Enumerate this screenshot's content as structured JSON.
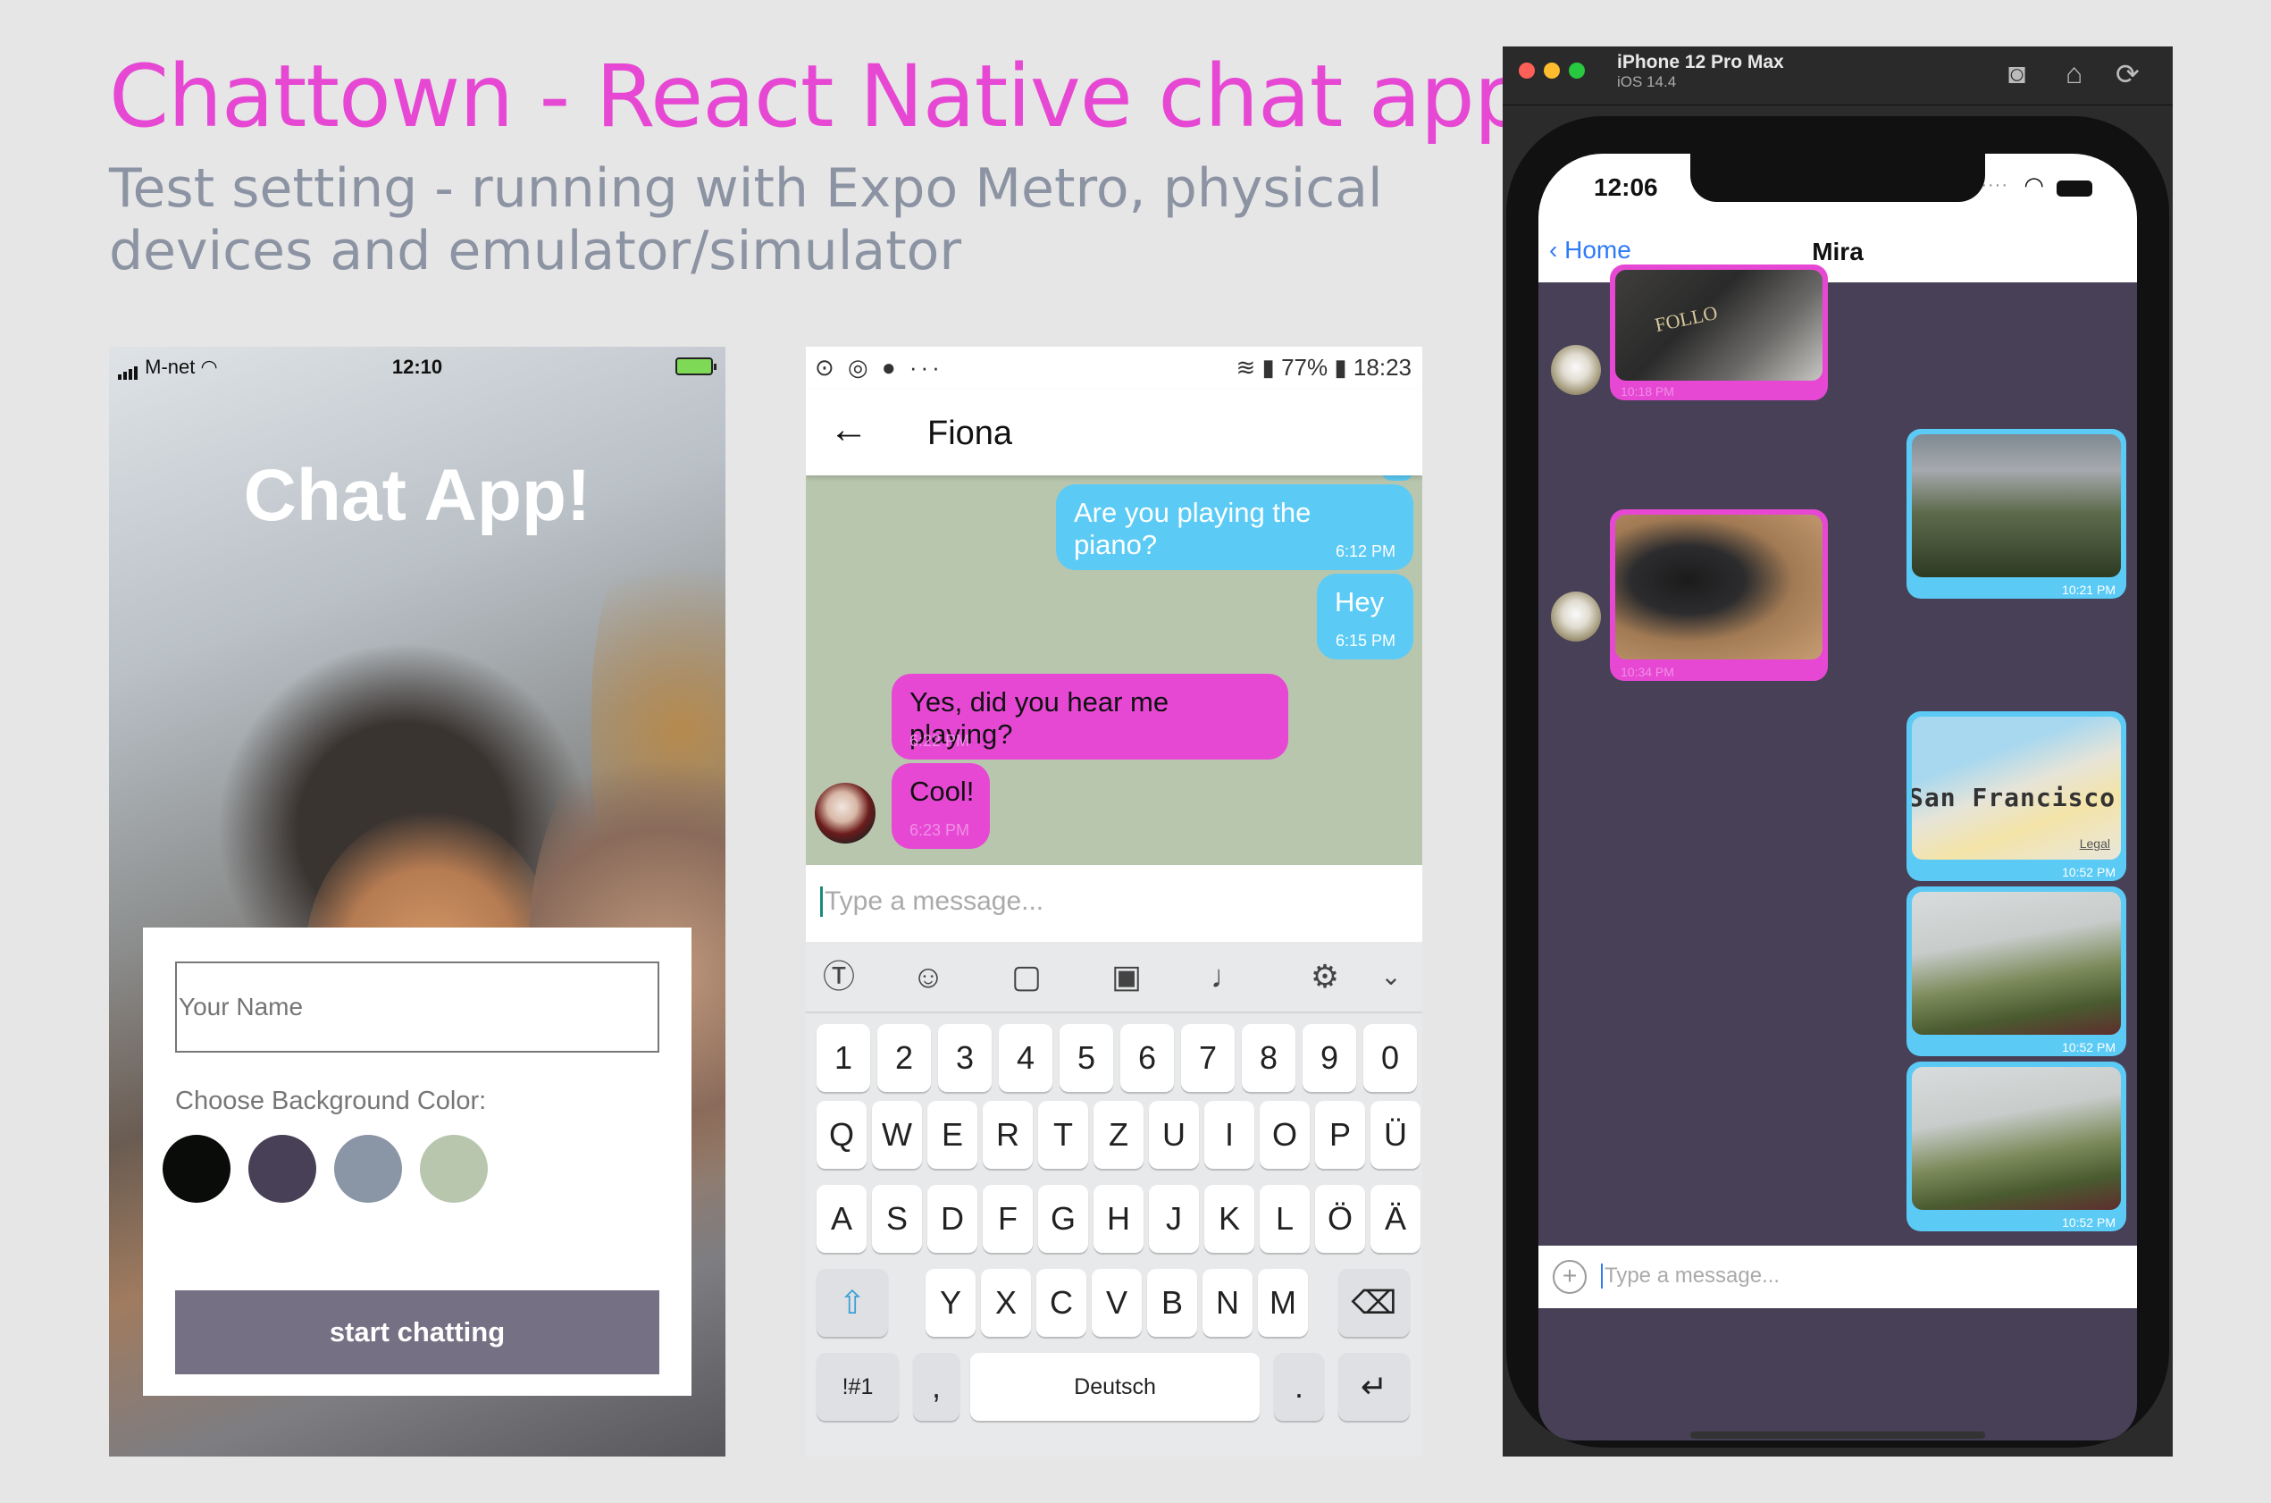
{
  "header": {
    "title": "Chattown - React Native chat app",
    "subtitle": "Test setting - running with Expo Metro, physical devices and emulator/simulator"
  },
  "login_screen": {
    "status": {
      "carrier": "M-net",
      "time": "12:10"
    },
    "app_title": "Chat App!",
    "name_placeholder": "Your Name",
    "bg_label": "Choose Background Color:",
    "colors": [
      "#090c08",
      "#474056",
      "#8a95a5",
      "#b9c6ae"
    ],
    "start_button": "start chatting"
  },
  "android_chat": {
    "status": {
      "left_icons": "⊙ ◎ ● ···",
      "battery": "77%",
      "time": "18:23"
    },
    "contact": "Fiona",
    "messages": [
      {
        "text": "Are you playing the piano?",
        "time": "6:12 PM",
        "side": "right"
      },
      {
        "text": "Hey",
        "time": "6:15 PM",
        "side": "right"
      },
      {
        "text": "Yes, did you hear me playing?",
        "time": "6:22 PM",
        "side": "left"
      },
      {
        "text": "Cool!",
        "time": "6:23 PM",
        "side": "left"
      }
    ],
    "input_placeholder": "Type a message...",
    "keyboard": {
      "tool_icons": [
        "text-mode-icon",
        "emoji-icon",
        "sticker-icon",
        "gif-icon",
        "mic-icon",
        "settings-icon",
        "collapse-icon"
      ],
      "row_numbers": [
        "1",
        "2",
        "3",
        "4",
        "5",
        "6",
        "7",
        "8",
        "9",
        "0"
      ],
      "row1": [
        "Q",
        "W",
        "E",
        "R",
        "T",
        "Z",
        "U",
        "I",
        "O",
        "P",
        "Ü"
      ],
      "row2": [
        "A",
        "S",
        "D",
        "F",
        "G",
        "H",
        "J",
        "K",
        "L",
        "Ö",
        "Ä"
      ],
      "row3": [
        "Y",
        "X",
        "C",
        "V",
        "B",
        "N",
        "M"
      ],
      "symbols": "!#1",
      "comma": ",",
      "space": "Deutsch",
      "period": "."
    }
  },
  "ios_sim": {
    "device": "iPhone 12 Pro Max",
    "os": "iOS 14.4",
    "phone_time": "12:06",
    "back_label": "Home",
    "contact": "Mira",
    "messages": [
      {
        "kind": "image",
        "time": "10:18 PM",
        "side": "left"
      },
      {
        "kind": "image",
        "time": "10:21 PM",
        "side": "right"
      },
      {
        "kind": "image",
        "time": "10:34 PM",
        "side": "left"
      },
      {
        "kind": "map",
        "time": "10:52 PM",
        "side": "right",
        "map_label": "San Francisco",
        "legal": "Legal"
      },
      {
        "kind": "image",
        "time": "10:52 PM",
        "side": "right"
      },
      {
        "kind": "image",
        "time": "10:52 PM",
        "side": "right"
      }
    ],
    "input_placeholder": "Type a message...",
    "image_text": "FOLLO"
  }
}
